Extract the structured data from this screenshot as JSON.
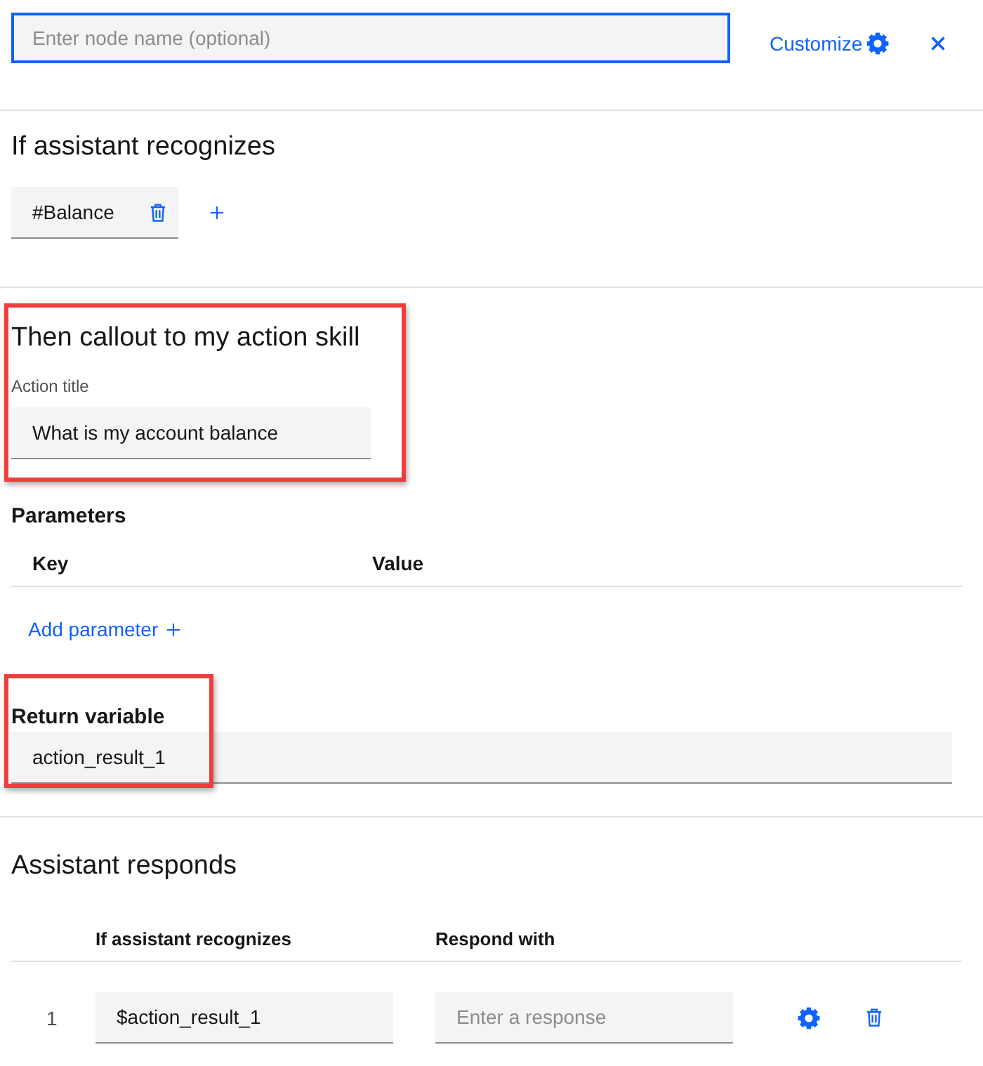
{
  "header": {
    "node_name": {
      "placeholder": "Enter node name (optional)",
      "focused": true
    },
    "customize": "Customize"
  },
  "recognizes": {
    "title": "If assistant recognizes",
    "conditions": [
      {
        "label": "#Balance"
      }
    ]
  },
  "action": {
    "title": "Then callout to my action skill",
    "highlighted": true,
    "action_title": {
      "label": "Action title",
      "value": "What is my account balance"
    }
  },
  "parameters": {
    "title": "Parameters",
    "columns": [
      "Key",
      "Value"
    ],
    "add_label": "Add parameter"
  },
  "return_variable": {
    "label": "Return variable",
    "value": "action_result_1",
    "highlighted": true
  },
  "responds": {
    "title": "Assistant responds",
    "columns": [
      "If assistant recognizes",
      "Respond with"
    ],
    "rows": [
      {
        "number": "1",
        "condition": {
          "value": "$action_result_1"
        },
        "response": {
          "placeholder": "Enter a response"
        }
      }
    ]
  }
}
